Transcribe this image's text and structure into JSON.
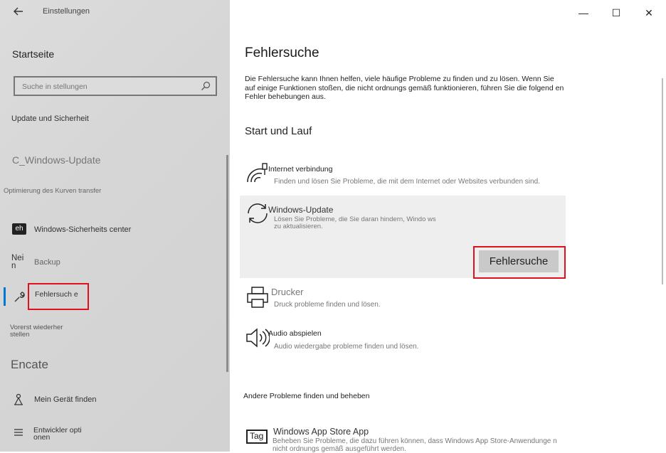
{
  "window": {
    "title": "Einstellungen",
    "controls": {
      "minimize": "—",
      "maximize": "☐",
      "close": "✕"
    }
  },
  "sidebar": {
    "home": "Startseite",
    "search": {
      "placeholder": "Suche in stellungen"
    },
    "category": "Update und Sicherheit",
    "windows_update": "C_Windows-Update",
    "optimization": "Optimierung des Kurven transfer",
    "items": [
      {
        "icon": "shield-icon",
        "glyph": "eh",
        "label": "Windows-Sicherheits center"
      },
      {
        "icon": "backup-icon",
        "glyph": "Nei n",
        "label": "Backup"
      },
      {
        "icon": "wrench-icon",
        "glyph": "",
        "label": "Fehlersuch e"
      },
      {
        "icon": "",
        "glyph": "",
        "label": "Vorerst wiederher stellen"
      }
    ],
    "group2": "Encate",
    "items2": [
      {
        "icon": "find-device-icon",
        "label": "Mein Gerät finden"
      },
      {
        "icon": "developer-icon",
        "label": "Entwickler opti onen"
      }
    ]
  },
  "main": {
    "title": "Fehlersuche",
    "description": "Die Fehlersuche kann Ihnen helfen, viele häufige Probleme zu finden und zu lösen. Wenn Sie auf einige Funktionen stoßen, die nicht ordnungs gemäß funktionieren, führen Sie die folgend en Fehler behebungen aus.",
    "section": "Start und Lauf",
    "troubleshooters": [
      {
        "icon": "wifi-icon",
        "title": "Internet verbindung",
        "desc": "Finden und lösen Sie Probleme, die mit dem Internet oder Websites verbunden sind."
      },
      {
        "icon": "sync-icon",
        "title": "Windows-Update",
        "desc": "Lösen Sie Probleme, die Sie daran hindern, Windo ws zu aktualisieren.",
        "button": "Fehlersuche"
      },
      {
        "icon": "printer-icon",
        "title": "Drucker",
        "desc": "Druck probleme finden und lösen."
      },
      {
        "icon": "speaker-icon",
        "title": "Audio abspielen",
        "desc": "Audio wiedergabe probleme finden und lösen."
      }
    ],
    "other_section": "Andere Probleme finden und beheben",
    "store": {
      "icon_text": "Tag",
      "title": "Windows App Store App",
      "desc": "Beheben Sie Probleme, die dazu führen können, dass Windows App Store-Anwendunge n nicht ordnungs gemäß ausgeführt werden."
    }
  }
}
